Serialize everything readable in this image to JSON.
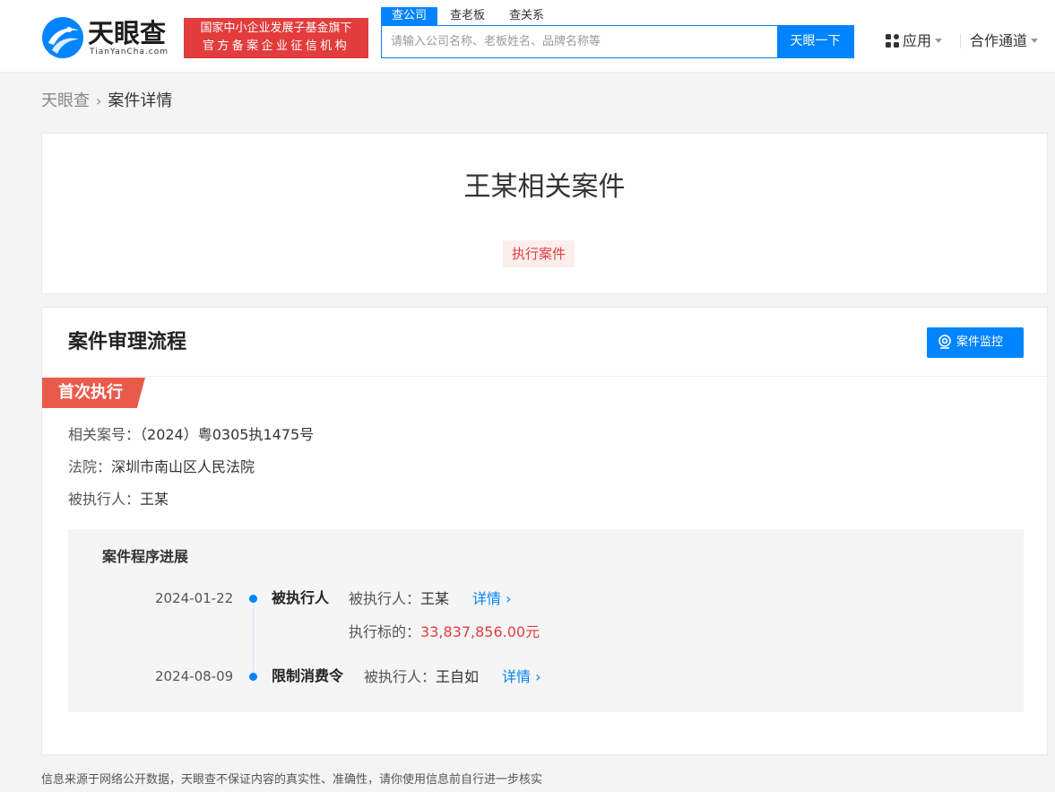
{
  "header": {
    "logo_text": "天眼查",
    "logo_domain": "TianYanCha.com",
    "badge_line1": "国家中小企业发展子基金旗下",
    "badge_line2": "官方备案企业征信机构",
    "search_tabs": [
      "查公司",
      "查老板",
      "查关系"
    ],
    "search_placeholder": "请输入公司名称、老板姓名、品牌名称等",
    "search_button": "天眼一下",
    "nav_app": "应用",
    "nav_partner": "合作通道"
  },
  "breadcrumb": {
    "home": "天眼查",
    "current": "案件详情"
  },
  "case": {
    "title": "王某相关案件",
    "tag": "执行案件"
  },
  "process": {
    "section_title": "案件审理流程",
    "monitor_button": "案件监控",
    "stage": "首次执行",
    "case_no_label": "相关案号：",
    "case_no": "（2024）粤0305执1475号",
    "court_label": "法院：",
    "court": "深圳市南山区人民法院",
    "executed_label": "被执行人：",
    "executed": "王某",
    "progress_title": "案件程序进展",
    "events": [
      {
        "date": "2024-01-22",
        "type": "被执行人",
        "party_label": "被执行人：",
        "party": "王某",
        "detail": "详情",
        "amount_label": "执行标的：",
        "amount": "33,837,856.00元"
      },
      {
        "date": "2024-08-09",
        "type": "限制消费令",
        "party_label": "被执行人：",
        "party": "王自如",
        "detail": "详情"
      }
    ]
  },
  "footer": {
    "note": "信息来源于网络公开数据，天眼查不保证内容的真实性、准确性，请你使用信息前自行进一步核实"
  },
  "colors": {
    "brand_blue": "#0084ff",
    "badge_red": "#e23c3c",
    "stage_red": "#e95a4a"
  }
}
